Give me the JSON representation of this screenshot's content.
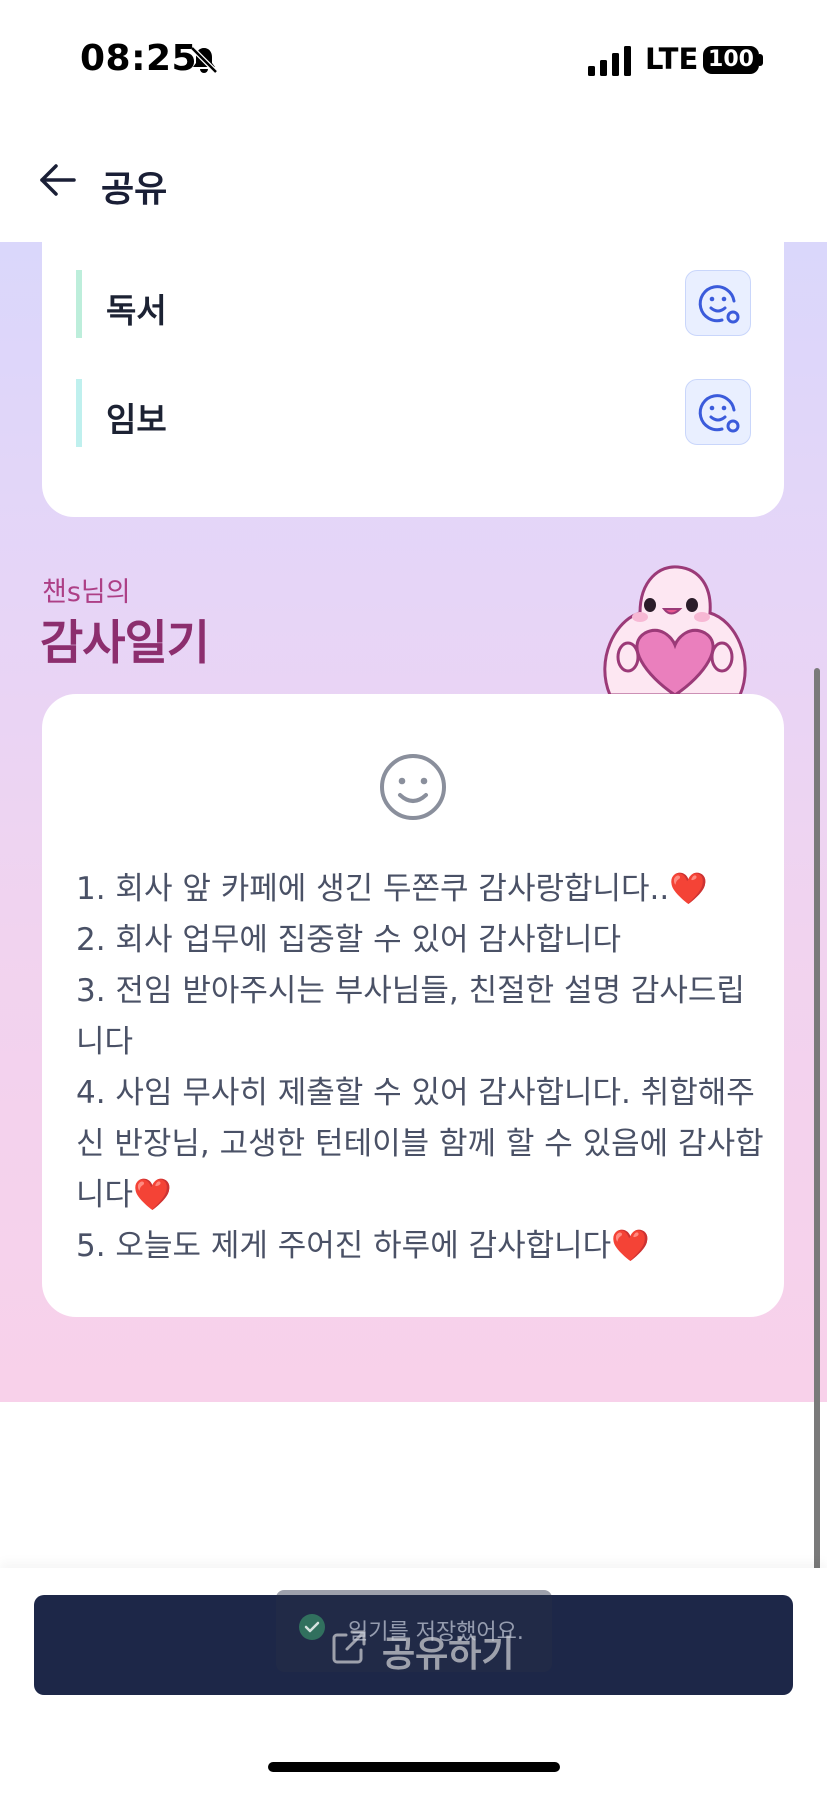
{
  "status_bar": {
    "time": "08:25",
    "network": "LTE",
    "battery": "100"
  },
  "header": {
    "title": "공유",
    "back_icon": "arrow-left-icon"
  },
  "routines": [
    {
      "label": "독서",
      "icon": "emoji-face-add-icon",
      "bar_color": "#bdeedb"
    },
    {
      "label": "임보",
      "icon": "emoji-face-add-icon",
      "bar_color": "#bff0ee"
    }
  ],
  "diary": {
    "owner": "챈s님의",
    "title": "감사일기",
    "mood_icon": "smile-face-icon",
    "lines": [
      "1. 회사 앞 카페에 생긴 두쫀쿠 감사랑합니다..❤️",
      "2. 회사 업무에 집중할 수 있어 감사합니다",
      "3. 전임 받아주시는 부사님들, 친절한 설명 감사드립니다",
      "4. 사임 무사히 제출할 수 있어 감사합니다. 취합해주신 반장님, 고생한 턴테이블 함께 할 수 있음에 감사합니다❤️",
      "5. 오늘도 제게 주어진 하루에 감사합니다❤️"
    ]
  },
  "toast": {
    "text": "일기를 저장했어요."
  },
  "share_button": {
    "label": "공유하기",
    "icon": "external-share-icon"
  },
  "colors": {
    "primary": "#1d2748",
    "title_pink": "#8c2e6e",
    "accent_blue": "#3b5bdb"
  }
}
